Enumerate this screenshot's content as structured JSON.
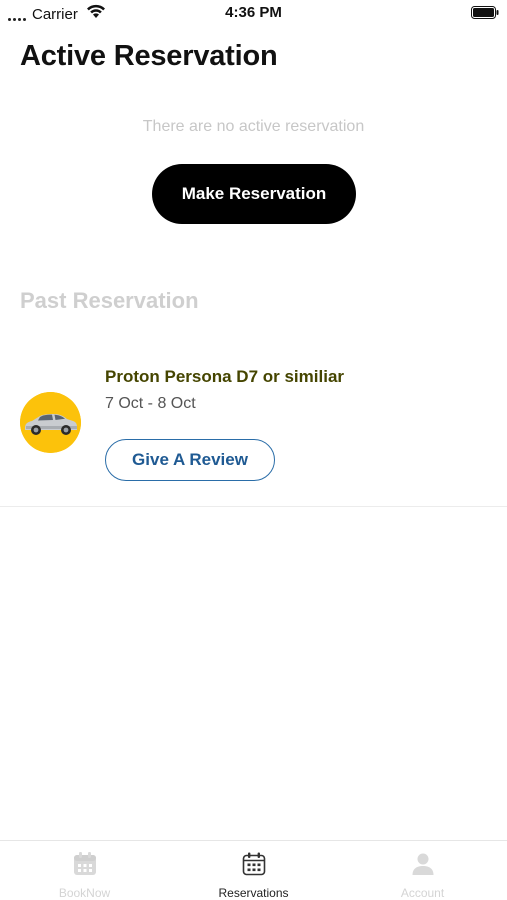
{
  "status_bar": {
    "carrier": "Carrier",
    "time": "4:36 PM"
  },
  "header": {
    "title": "Active Reservation"
  },
  "active": {
    "empty_message": "There are no active reservation",
    "make_reservation_label": "Make Reservation"
  },
  "past": {
    "section_title": "Past Reservation",
    "items": [
      {
        "car_name": "Proton Persona D7 or similiar",
        "dates": "7 Oct - 8 Oct",
        "review_label": "Give A Review",
        "image_icon": "car-icon"
      }
    ]
  },
  "tab_bar": {
    "tabs": [
      {
        "label": "BookNow",
        "icon": "calendar-icon",
        "active": false
      },
      {
        "label": "Reservations",
        "icon": "calendar-icon",
        "active": true
      },
      {
        "label": "Account",
        "icon": "user-icon",
        "active": false
      }
    ]
  },
  "colors": {
    "accent_yellow": "#fcc20b",
    "button_black": "#000000",
    "review_blue": "#1f5a93",
    "car_name_olive": "#454500"
  }
}
